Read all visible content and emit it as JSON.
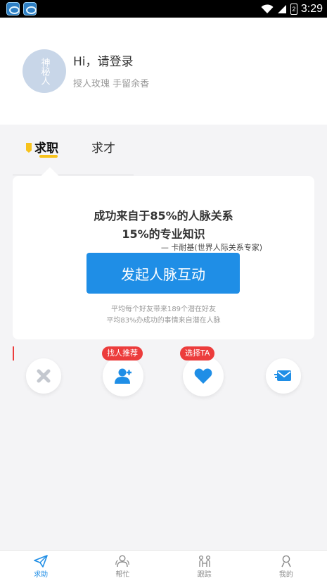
{
  "status_bar": {
    "time": "3:29",
    "battery_level": "2"
  },
  "profile": {
    "avatar_text": "神秘人",
    "greeting": "Hi，请登录",
    "motto": "授人玫瑰 手留余香"
  },
  "tabs": [
    {
      "label": "求职",
      "active": true
    },
    {
      "label": "求才",
      "active": false
    }
  ],
  "card": {
    "headline_line1": "成功来自于85%的人脉关系",
    "headline_line2": "15%的专业知识",
    "quote": "— 卡耐基(世界人际关系专家)",
    "cta_label": "发起人脉互动",
    "note_line1": "平均每个好友带来189个潜在好友",
    "note_line2": "平均83%办成功的事情来自潜在人脉"
  },
  "actions": {
    "recommend_tag": "找人推荐",
    "select_tag": "选择TA"
  },
  "bottom_nav": [
    {
      "label": "求助",
      "icon": "paper-plane-icon",
      "active": true
    },
    {
      "label": "帮忙",
      "icon": "people-icon",
      "active": false
    },
    {
      "label": "跟踪",
      "icon": "track-icon",
      "active": false
    },
    {
      "label": "我的",
      "icon": "person-icon",
      "active": false
    }
  ],
  "colors": {
    "accent": "#1f8ee6",
    "tag": "#ec3c3c",
    "highlight": "#f7c21b"
  }
}
